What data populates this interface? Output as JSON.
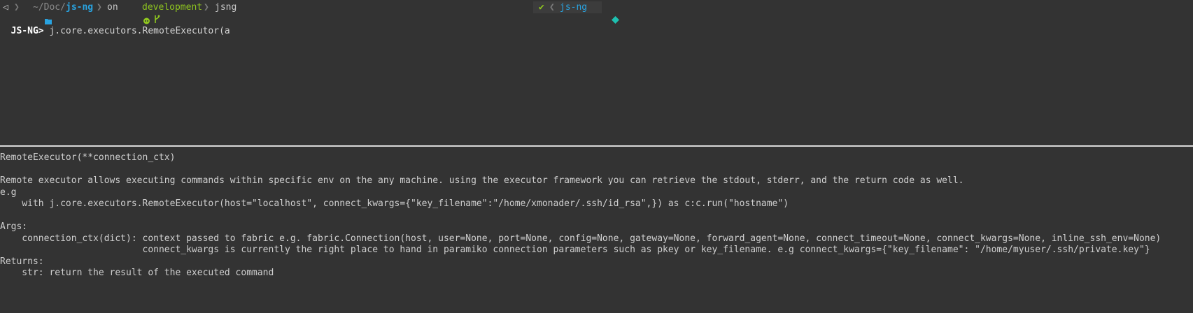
{
  "colors": {
    "background": "#333333",
    "path_accent": "#29a3e0",
    "branch": "#8fc61f",
    "divider": "#d9d9d9"
  },
  "statusline": {
    "back_glyph": "◁",
    "sep_glyph": "❯",
    "folder_icon": "folder-icon",
    "path_prefix": "~/Doc/",
    "path_current": "js-ng",
    "on_label": "on",
    "github_icon": "github-icon",
    "branch_icon": "git-branch-icon",
    "branch_name": "development",
    "command_name": "jsng",
    "venv_check": "✔",
    "venv_sep": "❮",
    "venv_name": "js-ng",
    "python_icon": "python-icon"
  },
  "repl": {
    "prompt": "JS-NG>",
    "input": " j.core.executors.RemoteExecutor(a"
  },
  "docstring": {
    "lines": [
      "RemoteExecutor(**connection_ctx)",
      "",
      "Remote executor allows executing commands within specific env on the any machine. using the executor framework you can retrieve the stdout, stderr, and the return code as well.",
      "e.g",
      "    with j.core.executors.RemoteExecutor(host=\"localhost\", connect_kwargs={\"key_filename\":\"/home/xmonader/.ssh/id_rsa\",}) as c:c.run(\"hostname\")",
      "",
      "Args:",
      "    connection_ctx(dict): context passed to fabric e.g. fabric.Connection(host, user=None, port=None, config=None, gateway=None, forward_agent=None, connect_timeout=None, connect_kwargs=None, inline_ssh_env=None)",
      "                          connect_kwargs is currently the right place to hand in paramiko connection parameters such as pkey or key_filename. e.g connect_kwargs={\"key_filename\": \"/home/myuser/.ssh/private.key\"}",
      "Returns:",
      "    str: return the result of the executed command"
    ]
  }
}
